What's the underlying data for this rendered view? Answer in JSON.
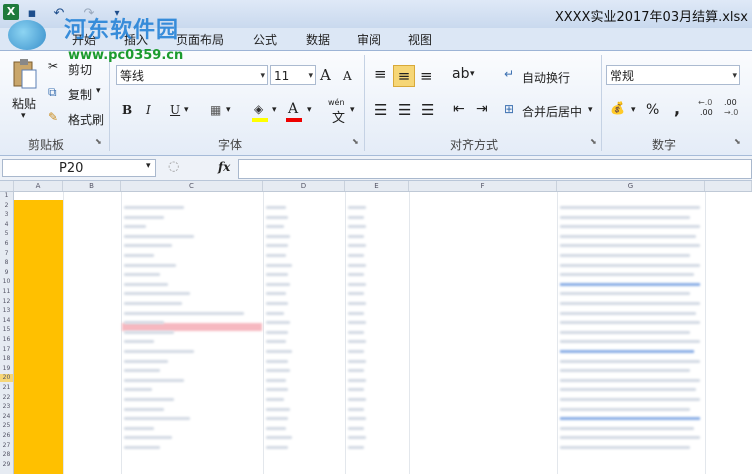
{
  "window": {
    "title": "XXXX实业2017年03月结算.xlsx"
  },
  "watermark": {
    "line1": "河东软件园",
    "line2": "www.pc0359.cn"
  },
  "quick_access": {
    "excel_icon": "X",
    "undo": "↶",
    "redo": "↷",
    "customize": "▾"
  },
  "tabs": [
    "开始",
    "插入",
    "页面布局",
    "公式",
    "数据",
    "审阅",
    "视图"
  ],
  "clipboard": {
    "paste": "粘贴",
    "cut": "剪切",
    "copy": "复制",
    "format_painter": "格式刷",
    "group": "剪贴板"
  },
  "font": {
    "name": "等线",
    "size": "11",
    "grow": "A",
    "shrink": "A",
    "bold": "B",
    "italic": "I",
    "underline": "U",
    "phonetic": "wén",
    "phonetic_char": "文",
    "group": "字体"
  },
  "alignment": {
    "wrap": "自动换行",
    "merge": "合并后居中",
    "group": "对齐方式"
  },
  "number": {
    "format": "常规",
    "percent": "%",
    "comma": ",",
    "inc_dec": ".00",
    "dec_dec": ".00",
    "group": "数字"
  },
  "formula_bar": {
    "name_box": "P20",
    "fx": "fx",
    "value": ""
  },
  "columns": [
    "A",
    "B",
    "C",
    "D",
    "E",
    "F",
    "G",
    ""
  ],
  "rows": [
    "1",
    "2",
    "3",
    "4",
    "5",
    "6",
    "7",
    "8",
    "9",
    "10",
    "11",
    "12",
    "13",
    "14",
    "15",
    "16",
    "17",
    "18",
    "19",
    "20",
    "21",
    "22",
    "23",
    "24",
    "25",
    "26",
    "27",
    "28",
    "29"
  ],
  "colors": {
    "selection_fill": "#ffc000",
    "ribbon_bg": "#e4ecf7",
    "file_tab": "#2b67b2"
  }
}
